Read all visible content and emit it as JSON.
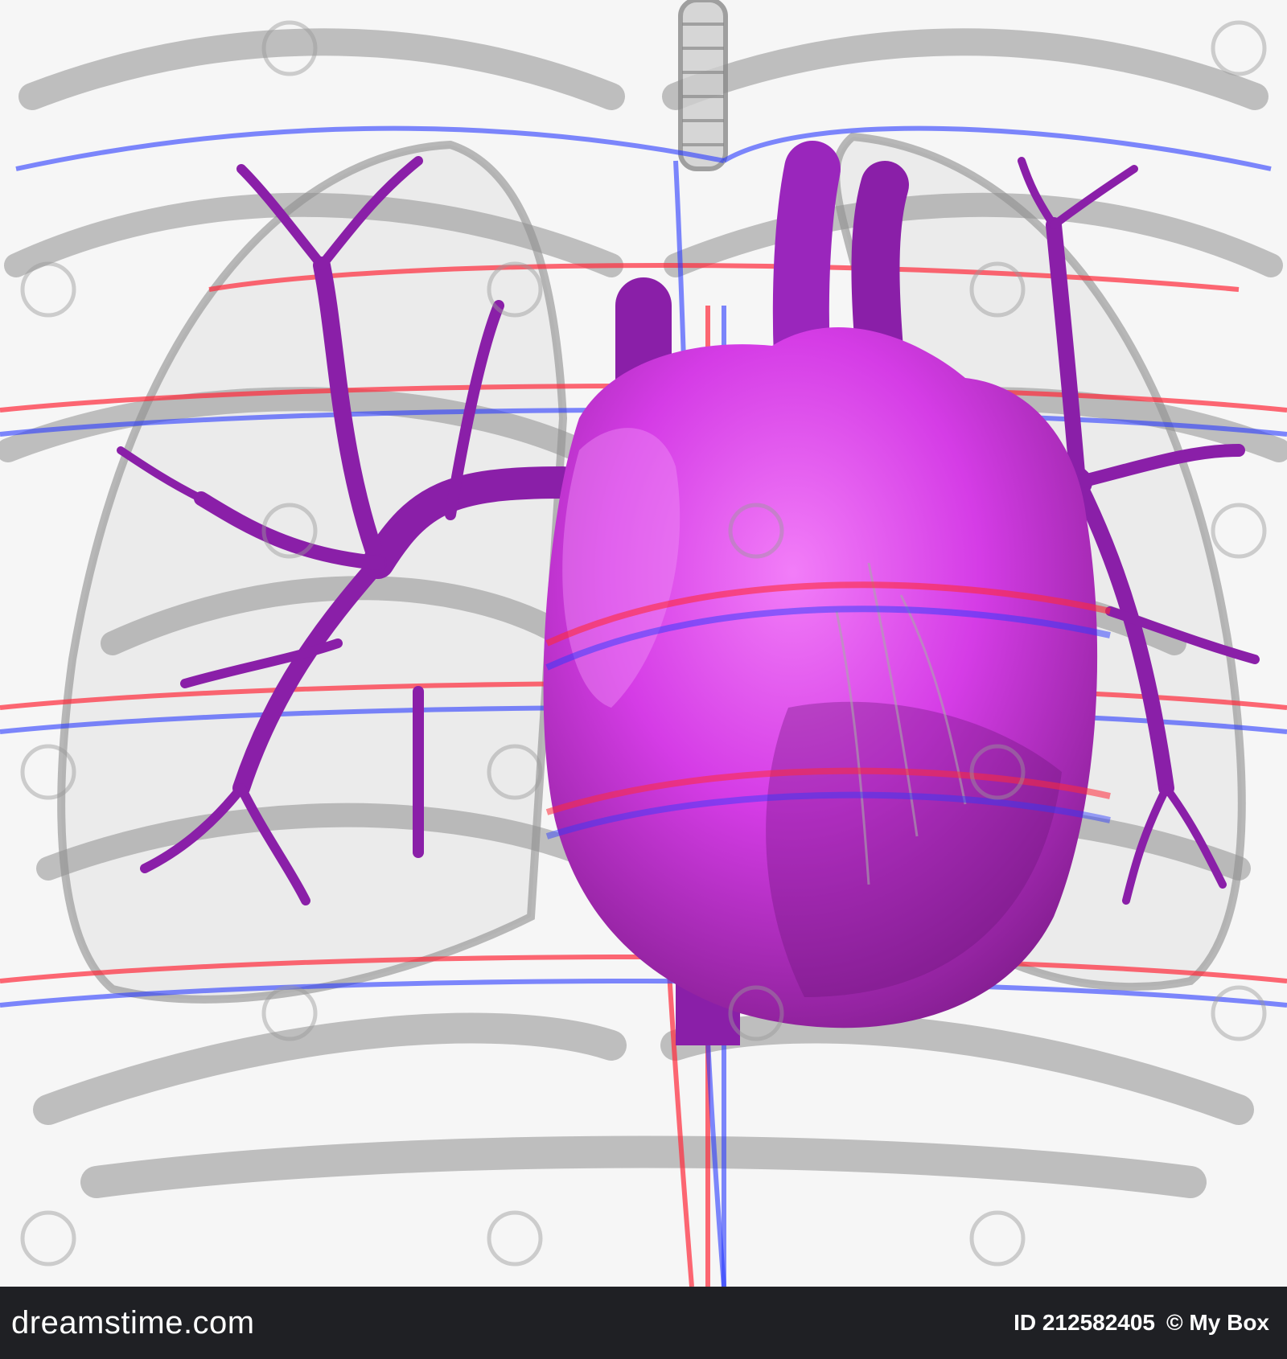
{
  "footer": {
    "brand": "dreamstime.com",
    "id_text": "ID 212582405",
    "credit": "© My Box"
  },
  "watermark": {
    "text": "dreamstime"
  },
  "colors": {
    "heart": "#d63ce6",
    "vessels": "#8a1fa8",
    "arteries_red": "#ff2a3a",
    "veins_blue": "#2a3aff",
    "bones_gray": "#9a9a9a",
    "footer_bg": "#1f2024"
  }
}
